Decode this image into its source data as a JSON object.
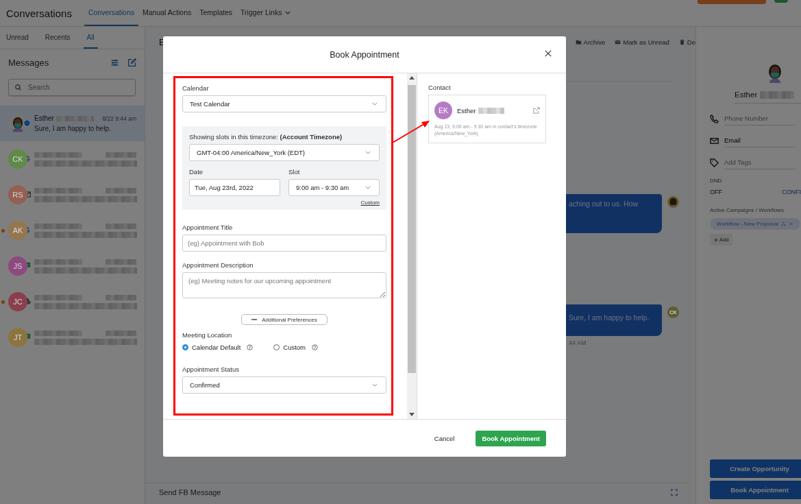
{
  "top_nav": {
    "title": "Conversations",
    "tabs": [
      {
        "label": "Conversations",
        "selected": true,
        "has_menu": false
      },
      {
        "label": "Manual Actions",
        "selected": false,
        "has_menu": false
      },
      {
        "label": "Templates",
        "selected": false,
        "has_menu": false
      },
      {
        "label": "Trigger Links",
        "selected": false,
        "has_menu": true
      }
    ]
  },
  "sidebar": {
    "tabs": [
      {
        "label": "Unread",
        "selected": false
      },
      {
        "label": "Recents",
        "selected": false
      },
      {
        "label": "All",
        "selected": true
      }
    ],
    "heading": "Messages",
    "search": {
      "placeholder": "Search"
    },
    "conversations": [
      {
        "kind": "picture",
        "name": "Esther",
        "time": "8/22 9:44 am",
        "preview": "Sure, I am happy to help.",
        "channel": {
          "kind": "messenger"
        },
        "selected": true,
        "unread": false
      },
      {
        "kind": "initials",
        "initials": "CK",
        "color": "#5f8a48",
        "channel": {
          "kind": "google"
        },
        "selected": false,
        "unread": false
      },
      {
        "kind": "initials",
        "initials": "RS",
        "color": "#946052",
        "channel": {
          "kind": "email"
        },
        "selected": false,
        "unread": false
      },
      {
        "kind": "initials",
        "initials": "AK",
        "color": "#96764f",
        "channel": {
          "kind": "google"
        },
        "selected": false,
        "unread": true
      },
      {
        "kind": "initials",
        "initials": "JS",
        "color": "#8d4a80",
        "channel": {
          "kind": "sms"
        },
        "selected": false,
        "unread": false
      },
      {
        "kind": "initials",
        "initials": "JC",
        "color": "#8a3f4c",
        "channel": {
          "kind": "chat"
        },
        "selected": false,
        "unread": true
      },
      {
        "kind": "initials",
        "initials": "JT",
        "color": "#8c7440",
        "channel": {
          "kind": "sms"
        },
        "selected": false,
        "unread": false
      }
    ]
  },
  "chat": {
    "header": "E",
    "actions": [
      {
        "kind": "archive",
        "label": "Archive"
      },
      {
        "kind": "mail",
        "label": "Mark as Unread"
      },
      {
        "kind": "trash",
        "label": "De"
      }
    ],
    "messages": [
      {
        "kind": "picture",
        "text": "aching out to us. How"
      },
      {
        "kind": "initials",
        "initials": "CK",
        "text": "Sure, I am happy to help.",
        "time": "44 AM"
      }
    ],
    "composer": {
      "label": "Send FB Message"
    }
  },
  "contact_panel": {
    "name": "Esther",
    "fields": [
      {
        "kind": "phone",
        "placeholder": "Phone Number"
      },
      {
        "kind": "email",
        "value": "Email"
      },
      {
        "kind": "tag",
        "placeholder": "Add Tags"
      }
    ],
    "dnd": {
      "label": "DND",
      "value": "OFF",
      "action": "CONFI"
    },
    "campaigns": {
      "label": "Active Campaigns / Workflows",
      "items": [
        "Workflow - New Proposal"
      ],
      "add": "Add"
    },
    "buttons": [
      "Create Opportunity",
      "Book Appointment"
    ]
  },
  "modal": {
    "title": "Book Appointment",
    "calendar": {
      "label": "Calendar",
      "value": "Test Calendar"
    },
    "timezone": {
      "label": "Showing slots in this timezone: **(Account Timezone)**",
      "value": "GMT-04:00 America/New_York (EDT)"
    },
    "date": {
      "label": "Date",
      "value": "Tue, Aug 23rd, 2022"
    },
    "slot": {
      "label": "Slot",
      "value": "9:00 am - 9:30 am"
    },
    "custom_link": "Custom",
    "appointment_title": {
      "label": "Appointment Title",
      "placeholder": "(eg) Appointment with Bob"
    },
    "description": {
      "label": "Appointment Description",
      "placeholder": "(eg) Meeting notes for our upcoming appointment"
    },
    "preferences_button": "Additional Preferences",
    "meeting_location": {
      "label": "Meeting Location",
      "options": [
        {
          "label": "Calendar Default",
          "selected": true
        },
        {
          "label": "Custom",
          "selected": false
        }
      ]
    },
    "status": {
      "label": "Appointment Status",
      "value": "Confirmed"
    },
    "contact": {
      "label": "Contact",
      "initials": "EK",
      "name": "Esther",
      "note": "Aug 23, 9:00 am - 9:30 am in contact's timezone (America/New_York)"
    },
    "buttons": {
      "cancel": "Cancel",
      "submit": "Book Appointment"
    }
  }
}
